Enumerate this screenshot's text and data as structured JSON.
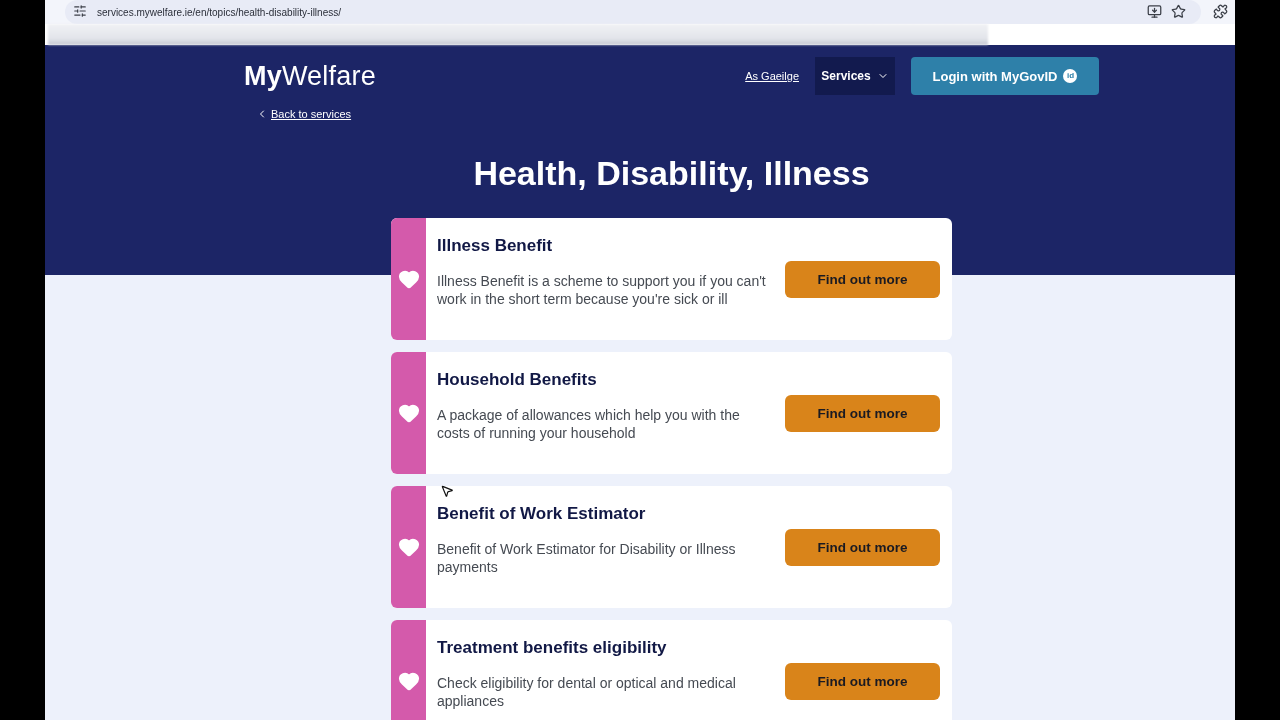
{
  "browser": {
    "url": "services.mywelfare.ie/en/topics/health-disability-illness/"
  },
  "header": {
    "logo": "**My**Welfare",
    "language_link": "As Gaeilge",
    "services_menu": {
      "label": "Services",
      "expanded": false
    },
    "login_button": {
      "label": "Login with MyGovID",
      "badge": "id"
    },
    "back_link": "Back to services"
  },
  "page_title": "Health, Disability, Illness",
  "services": [
    {
      "title": "Illness Benefit",
      "description": "Illness Benefit is a scheme to support you if you can't work in the short term because you're sick or ill",
      "button": "Find out more"
    },
    {
      "title": "Household Benefits",
      "description": "A package of allowances which help you with the costs of running your household",
      "button": "Find out more"
    },
    {
      "title": "Benefit of Work Estimator",
      "description": "Benefit of Work Estimator for Disability or Illness payments",
      "button": "Find out more"
    },
    {
      "title": "Treatment benefits eligibility",
      "description": "Check eligibility for dental or optical and medical appliances",
      "button": "Find out more"
    }
  ]
}
